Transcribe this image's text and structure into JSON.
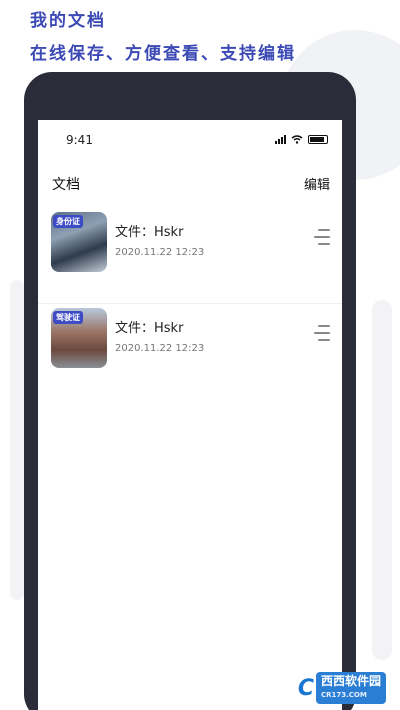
{
  "promo": {
    "headline": "我的文档",
    "subheadline": "在线保存、方便查看、支持编辑"
  },
  "status_bar": {
    "time": "9:41"
  },
  "nav": {
    "title": "文档",
    "edit_label": "编辑"
  },
  "documents": [
    {
      "tag": "身份证",
      "name": "文件：Hskr",
      "date": "2020.11.22  12:23"
    },
    {
      "tag": "驾驶证",
      "name": "文件：Hskr",
      "date": "2020.11.22  12:23"
    }
  ],
  "watermark": {
    "brand": "西西软件园",
    "domain": "CR173.COM"
  },
  "colors": {
    "accent": "#3c4ab5",
    "phone_frame": "#2a2c3a",
    "tag_bg": "#3d4cc4"
  },
  "icons": [
    "signal-icon",
    "wifi-icon",
    "battery-icon",
    "drag-handle-icon"
  ]
}
